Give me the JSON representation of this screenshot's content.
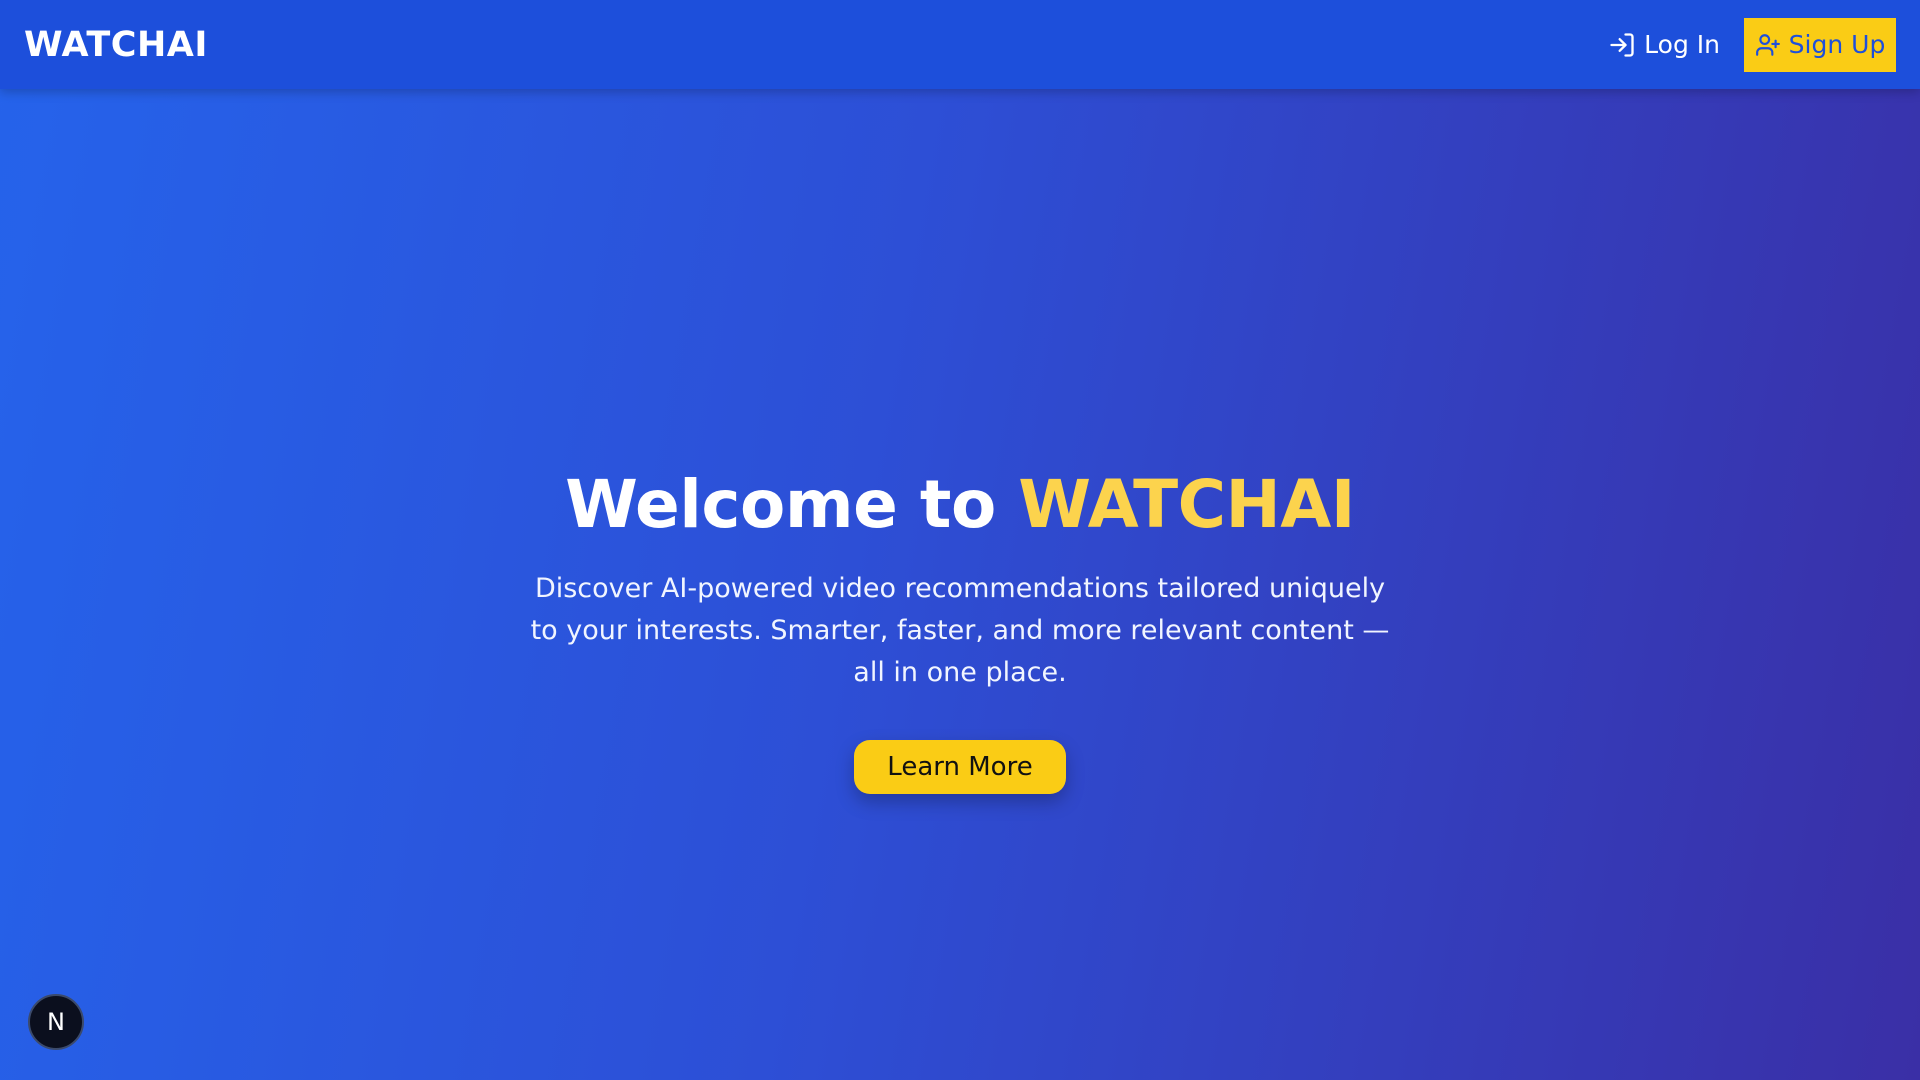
{
  "navbar": {
    "logo": "WATCHAI",
    "login_label": "Log In",
    "signup_label": "Sign Up",
    "login_icon": "login-arrow-icon",
    "signup_icon": "user-plus-icon"
  },
  "hero": {
    "title_prefix": "Welcome to ",
    "title_brand": "WATCHAI",
    "description": "Discover AI-powered video recommendations tailored uniquely to your interests. Smarter, faster, and more relevant content — all in one place.",
    "cta_label": "Learn More"
  },
  "badge": {
    "label": "N"
  },
  "colors": {
    "navbar_bg": "#1d4fdb",
    "accent_yellow": "#facc15",
    "brand_yellow": "#fcd34d",
    "gradient_start": "#2563eb",
    "gradient_end": "#3a2fa6"
  }
}
